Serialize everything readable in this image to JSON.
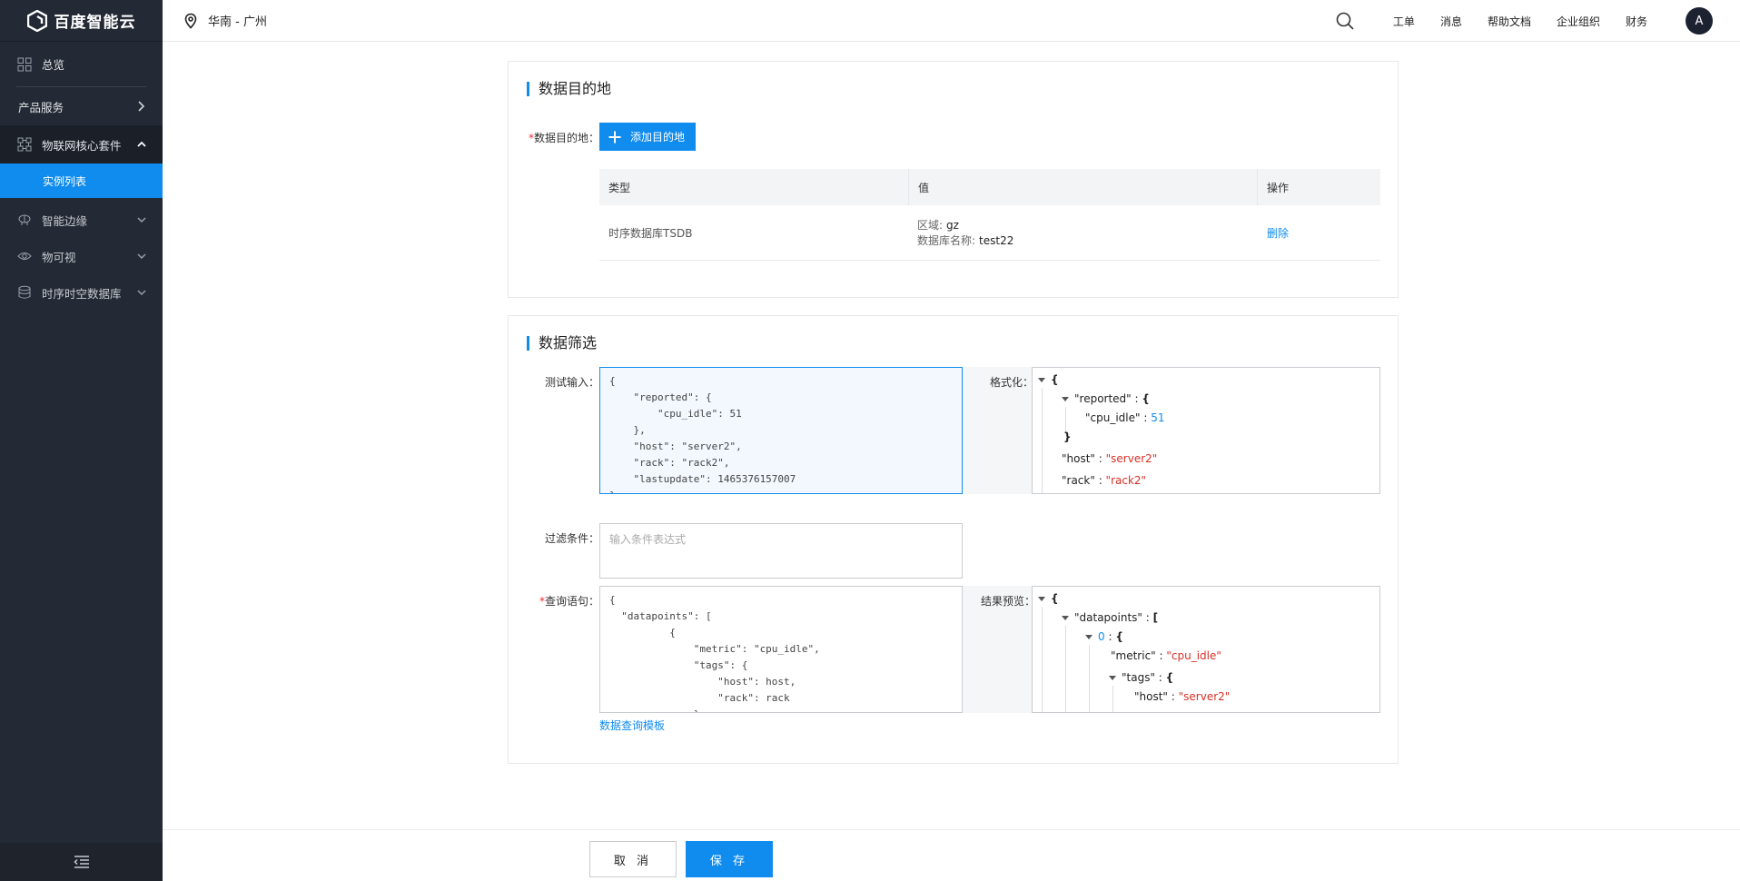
{
  "sidebar": {
    "logo_text": "百度智能云",
    "items": [
      {
        "label": "总览",
        "icon": "grid-icon"
      },
      {
        "label": "产品服务",
        "icon": ""
      },
      {
        "label": "物联网核心套件",
        "icon": "iot-core-icon"
      },
      {
        "label": "实例列表",
        "icon": ""
      },
      {
        "label": "智能边缘",
        "icon": "edge-icon"
      },
      {
        "label": "物可视",
        "icon": "eye-icon"
      },
      {
        "label": "时序时空数据库",
        "icon": "database-icon"
      }
    ],
    "footer_icon": "collapse-menu-icon"
  },
  "topbar": {
    "region": "华南 - 广州",
    "links": [
      "工单",
      "消息",
      "帮助文档",
      "企业组织",
      "财务"
    ],
    "avatar": "A"
  },
  "dest_section": {
    "title": "数据目的地",
    "field_label": "数据目的地：",
    "add_button": "添加目的地",
    "table": {
      "headers": [
        "类型",
        "值",
        "操作"
      ],
      "rows": [
        {
          "type": "时序数据库TSDB",
          "region_key": "区域:",
          "region_val": "gz",
          "db_key": "数据库名称:",
          "db_val": "test22",
          "action": "删除"
        }
      ]
    }
  },
  "filter_section": {
    "title": "数据筛选",
    "test_input_label": "测试输入：",
    "test_input_value": "{\n    \"reported\": {\n        \"cpu_idle\": 51\n    },\n    \"host\": \"server2\",\n    \"rack\": \"rack2\",\n    \"lastupdate\": 1465376157007\n}",
    "format_label": "格式化：",
    "format_preview": {
      "reported_key": "\"reported\"",
      "cpu_idle_key": "\"cpu_idle\"",
      "cpu_idle_val": "51",
      "host_key": "\"host\"",
      "host_val": "\"server2\"",
      "rack_key": "\"rack\"",
      "rack_val": "\"rack2\""
    },
    "condition_label": "过滤条件：",
    "condition_placeholder": "输入条件表达式",
    "query_label": "查询语句：",
    "query_value": "{\n  \"datapoints\": [\n          {\n              \"metric\": \"cpu_idle\",\n              \"tags\": {\n                  \"host\": host,\n                  \"rack\": rack\n              }",
    "result_label": "结果预览：",
    "result_preview": {
      "datapoints_key": "\"datapoints\"",
      "index": "0",
      "metric_key": "\"metric\"",
      "metric_val": "\"cpu_idle\"",
      "tags_key": "\"tags\"",
      "host_key": "\"host\"",
      "host_val": "\"server2\""
    },
    "template_link": "数据查询模板"
  },
  "footer": {
    "cancel": "取 消",
    "save": "保 存"
  }
}
